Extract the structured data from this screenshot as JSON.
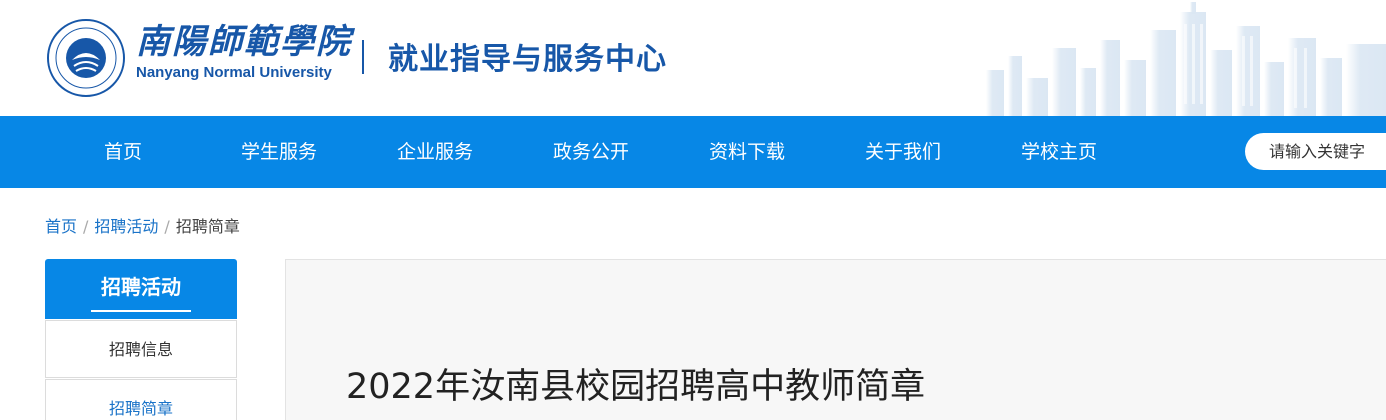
{
  "header": {
    "logo_icon": "university-seal-icon",
    "university_cn": "南陽師範學院",
    "university_en": "Nanyang Normal University",
    "department": "就业指导与服务中心",
    "brand_color": "#1757a8"
  },
  "nav": {
    "background": "#0787e6",
    "items": [
      {
        "label": "首页"
      },
      {
        "label": "学生服务"
      },
      {
        "label": "企业服务"
      },
      {
        "label": "政务公开"
      },
      {
        "label": "资料下载"
      },
      {
        "label": "关于我们"
      },
      {
        "label": "学校主页"
      }
    ],
    "search": {
      "placeholder": "请输入关键字"
    }
  },
  "breadcrumb": {
    "items": [
      "首页",
      "招聘活动",
      "招聘简章"
    ]
  },
  "sidebar": {
    "title": "招聘活动",
    "items": [
      {
        "label": "招聘信息",
        "active": false
      },
      {
        "label": "招聘简章",
        "active": true
      }
    ]
  },
  "article": {
    "title": "2022年汝南县校园招聘高中教师简章"
  }
}
